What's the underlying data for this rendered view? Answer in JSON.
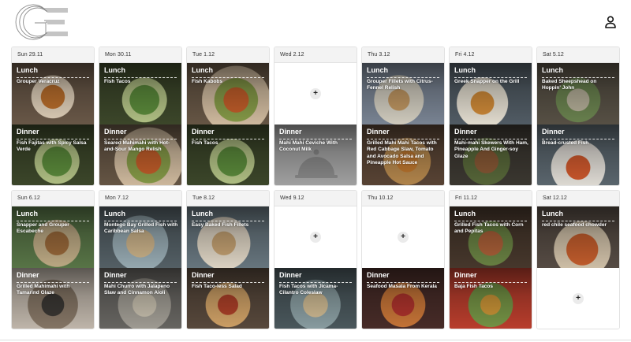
{
  "header": {
    "logo_icon": "ge-logo-icon",
    "user_icon": "user-icon"
  },
  "labels": {
    "lunch": "Lunch",
    "dinner": "Dinner",
    "add": "+"
  },
  "weeks": [
    {
      "days": [
        {
          "date": "Sun 29.11",
          "lunch": "Grouper Veracruz",
          "dinner": "Fish Fajitas with Spicy Salsa Verde"
        },
        {
          "date": "Mon 30.11",
          "lunch": "Fish Tacos",
          "dinner": "Seared Mahimahi with Hot-and-Sour Mango Relish"
        },
        {
          "date": "Tue 1.12",
          "lunch": "Fish Kabobs",
          "dinner": "Fish Tacos"
        },
        {
          "date": "Wed 2.12",
          "lunch": "",
          "dinner": "Mahi Mahi Ceviche With Coconut Milk"
        },
        {
          "date": "Thu 3.12",
          "lunch": "Grouper Fillets with Citrus-Fennel Relish",
          "dinner": "Grilled Mahi Mahi Tacos with Red Cabbage Slaw, Tomato and Avocado Salsa and Pineapple Hot Sauce"
        },
        {
          "date": "Fri 4.12",
          "lunch": "Greek Snapper on the Grill",
          "dinner": "Mahi-mahi Skewers With Ham, Pineapple And Ginger-soy Glaze"
        },
        {
          "date": "Sat 5.12",
          "lunch": "Baked Sheepshead on Hoppin' John",
          "dinner": "Bread-crusted Fish"
        }
      ]
    },
    {
      "days": [
        {
          "date": "Sun 6.12",
          "lunch": "Snapper and Grouper Escabeche",
          "dinner": "Grilled Mahimahi with Tamarind Glaze"
        },
        {
          "date": "Mon 7.12",
          "lunch": "Montego Bay Grilled Fish with Caribbean Salsa",
          "dinner": "Mahi Churro with Jalapeno Slaw and Cinnamon Aioli"
        },
        {
          "date": "Tue 8.12",
          "lunch": "Easy Baked Fish Fillets",
          "dinner": "Fish Taco-less Salad"
        },
        {
          "date": "Wed 9.12",
          "lunch": "",
          "dinner": "Fish Tacos with Jicama-Cilantro Coleslaw"
        },
        {
          "date": "Thu 10.12",
          "lunch": "",
          "dinner": "Seafood Masala From Kerala"
        },
        {
          "date": "Fri 11.12",
          "lunch": "Grilled Fish Tacos with Corn and Pepitas",
          "dinner": "Baja Fish Tacos"
        },
        {
          "date": "Sat 12.12",
          "lunch": "red chile seafood chowder",
          "dinner": ""
        }
      ]
    }
  ]
}
